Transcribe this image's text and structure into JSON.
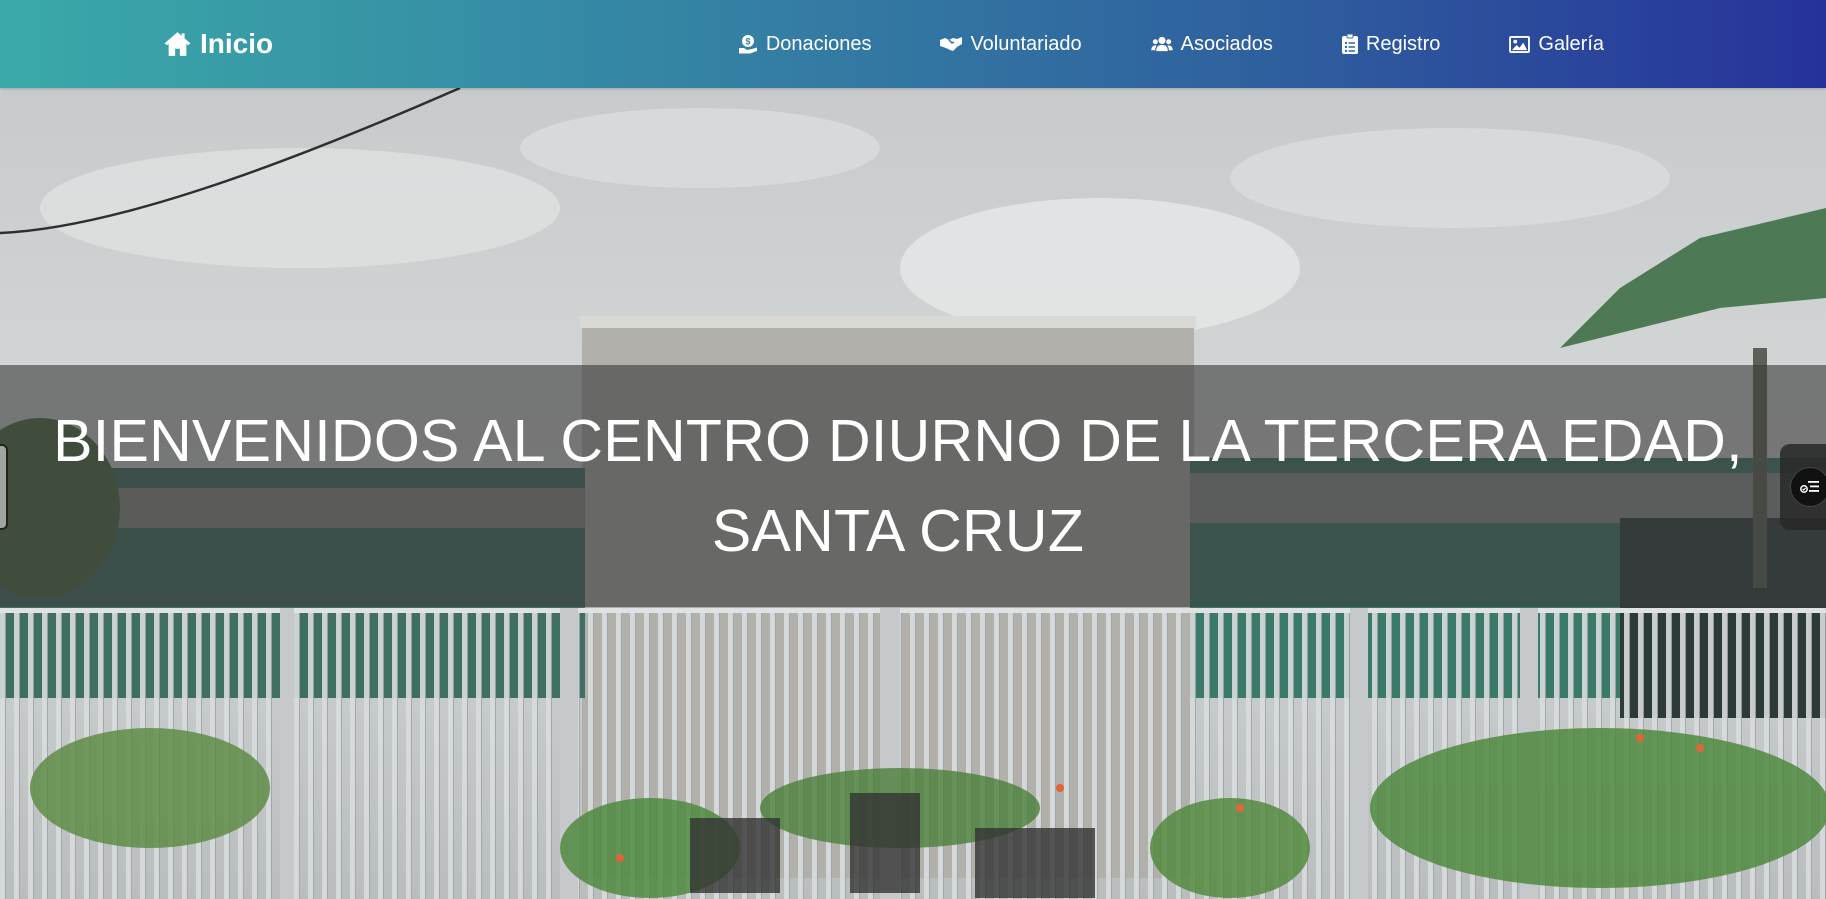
{
  "navbar": {
    "brand": {
      "label": "Inicio",
      "icon": "home-icon"
    },
    "links": [
      {
        "label": "Donaciones",
        "icon": "hand-holding-dollar-icon"
      },
      {
        "label": "Voluntariado",
        "icon": "handshake-icon"
      },
      {
        "label": "Asociados",
        "icon": "users-icon"
      },
      {
        "label": "Registro",
        "icon": "clipboard-list-icon"
      },
      {
        "label": "Galería",
        "icon": "image-icon"
      }
    ],
    "gradient": [
      "#3aa9a8",
      "#3586a5",
      "#2f5f9e",
      "#26329a"
    ]
  },
  "hero": {
    "title": "BIENVENIDOS AL CENTRO DIURNO DE LA TERCERA EDAD, SANTA CRUZ",
    "image": "photo of building facade behind a metal fence with garden under a cloudy sky",
    "overlay_color": "#3c3c3c"
  },
  "widgets": {
    "right": {
      "icon": "accessibility-menu-icon"
    },
    "left": {
      "icon": "side-tab-handle"
    }
  }
}
